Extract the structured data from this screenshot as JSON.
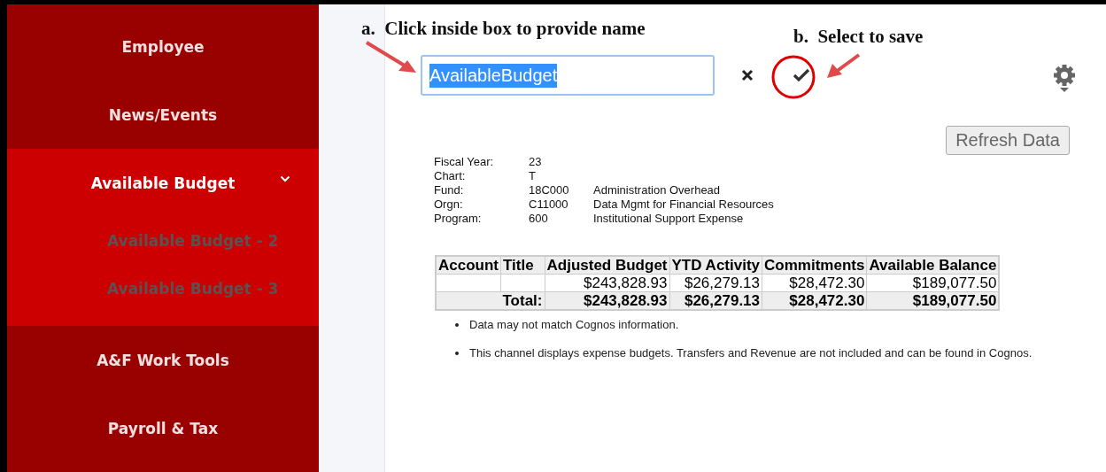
{
  "sidebar": {
    "items": [
      {
        "label": "Employee",
        "selected": false
      },
      {
        "label": "News/Events",
        "selected": false
      },
      {
        "label": "Available Budget",
        "selected": true,
        "expanded": true,
        "children": [
          {
            "label": "Available Budget - 2"
          },
          {
            "label": "Available Budget - 3"
          }
        ]
      },
      {
        "label": "A&F Work Tools",
        "selected": false
      },
      {
        "label": "Payroll & Tax",
        "selected": false
      }
    ]
  },
  "annotations": [
    {
      "marker": "a.",
      "text": "Click inside box to provide name"
    },
    {
      "marker": "b.",
      "text": "Select to save"
    }
  ],
  "name_field": {
    "value": "AvailableBudget",
    "text_selected": true
  },
  "refresh_button": "Refresh Data",
  "info": [
    {
      "label": "Fiscal Year:",
      "code": "23"
    },
    {
      "label": "Chart:",
      "code": "T"
    },
    {
      "label": "Fund:",
      "code": "18C000",
      "description": "Administration Overhead"
    },
    {
      "label": "Orgn:",
      "code": "C11000",
      "description": "Data Mgmt for Financial Resources"
    },
    {
      "label": "Program:",
      "code": "600",
      "description": "Institutional Support Expense"
    }
  ],
  "table": {
    "columns": [
      "Account",
      "Title",
      "Adjusted Budget",
      "YTD Activity",
      "Commitments",
      "Available Balance"
    ],
    "rows": [
      {
        "kind": "data",
        "cells": [
          "",
          "",
          "$243,828.93",
          "$26,279.13",
          "$28,472.30",
          "$189,077.50"
        ]
      },
      {
        "kind": "total",
        "cells": [
          "",
          "Total:",
          "$243,828.93",
          "$26,279.13",
          "$28,472.30",
          "$189,077.50"
        ]
      }
    ]
  },
  "notes": [
    "Data may not match Cognos information.",
    "This channel displays expense budgets. Transfers and Revenue are not included and can be found in Cognos."
  ]
}
